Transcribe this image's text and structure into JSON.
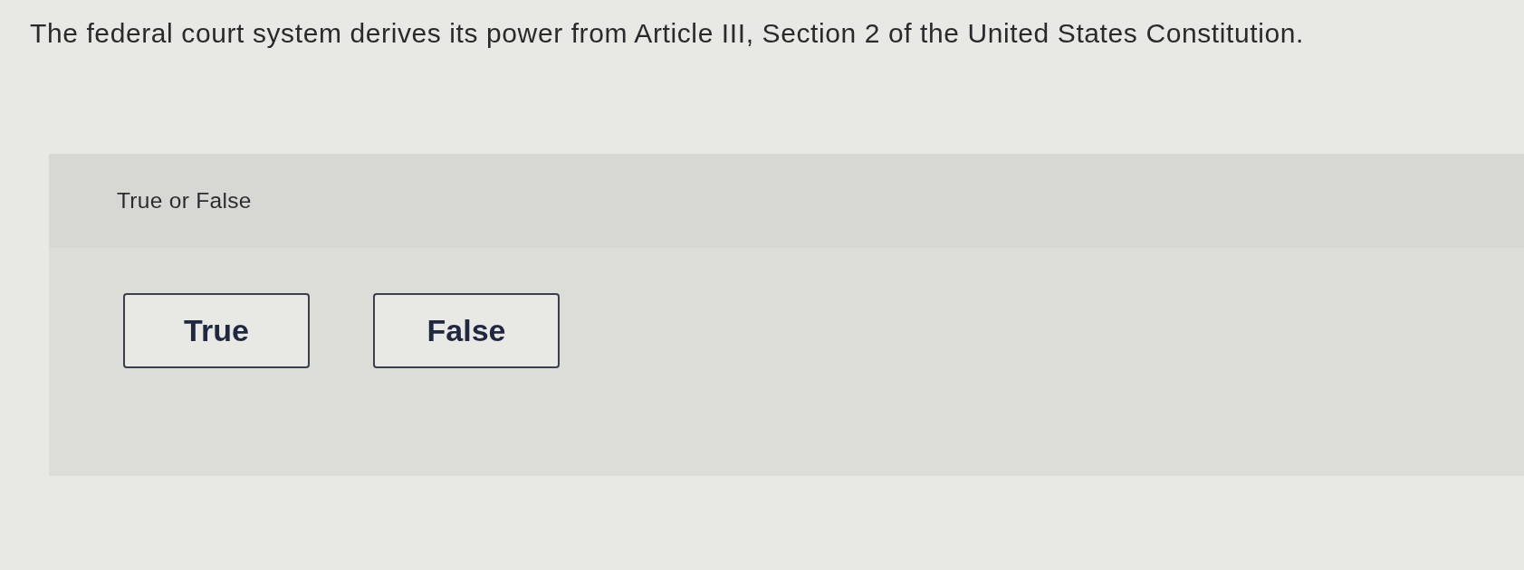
{
  "question": {
    "text": "The federal court system derives its power from Article III, Section 2 of the United States Constitution."
  },
  "answer_panel": {
    "prompt": "True or False",
    "options": [
      {
        "label": "True",
        "selected": false
      },
      {
        "label": "False",
        "selected": false
      }
    ]
  }
}
